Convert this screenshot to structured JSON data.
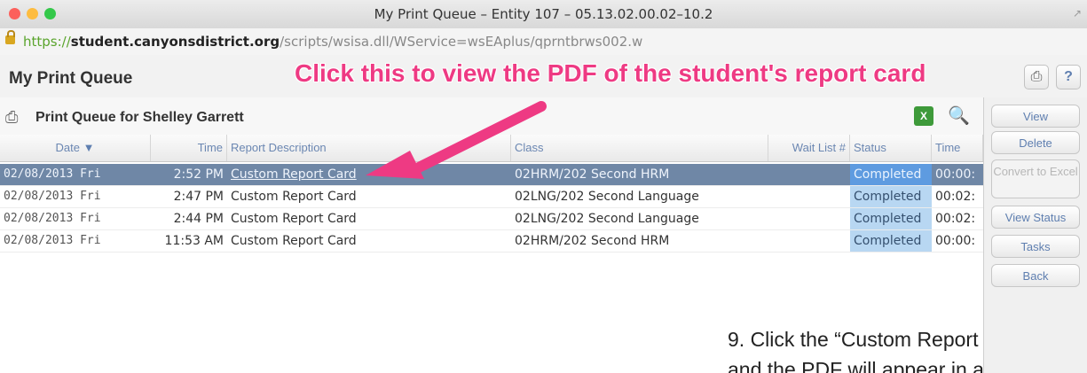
{
  "window": {
    "title": "My Print Queue – Entity 107 – 05.13.02.00.02–10.2",
    "controls": {
      "close_color": "#fc605c",
      "minimize_color": "#fdbc40",
      "zoom_color": "#34c84a"
    }
  },
  "address_bar": {
    "scheme": "https://",
    "host": "student.canyonsdistrict.org",
    "path": "/scripts/wsisa.dll/WService=wsEAplus/qprntbrws002.w"
  },
  "app": {
    "title": "My Print Queue",
    "header_icons": [
      "printer-icon",
      "help-icon"
    ],
    "help_label": "?"
  },
  "annotation": {
    "callout": "Click this to view the PDF of the student's report card",
    "callout_color": "#ee3a83",
    "instruction_line1": "9.  Click the “Custom Report",
    "instruction_line2": "and the PDF will appear in a"
  },
  "queue": {
    "heading": "Print Queue for Shelley Garrett",
    "toolbar_icons": [
      "excel-export-icon",
      "preview-icon"
    ],
    "columns": [
      "Date",
      "Time",
      "Report Description",
      "Class",
      "Wait List #",
      "Status",
      "Time"
    ],
    "rows": [
      {
        "date": "02/08/2013 Fri",
        "time": "2:52 PM",
        "description": "Custom Report Card",
        "class": "02HRM/202 Second HRM",
        "wait_list": "",
        "status": "Completed",
        "elapsed": "00:00:",
        "selected": true
      },
      {
        "date": "02/08/2013 Fri",
        "time": "2:47 PM",
        "description": "Custom Report Card",
        "class": "02LNG/202 Second Language",
        "wait_list": "",
        "status": "Completed",
        "elapsed": "00:02:",
        "selected": false
      },
      {
        "date": "02/08/2013 Fri",
        "time": "2:44 PM",
        "description": "Custom Report Card",
        "class": "02LNG/202 Second Language",
        "wait_list": "",
        "status": "Completed",
        "elapsed": "00:02:",
        "selected": false
      },
      {
        "date": "02/08/2013 Fri",
        "time": "11:53 AM",
        "description": "Custom Report Card",
        "class": "02HRM/202 Second HRM",
        "wait_list": "",
        "status": "Completed",
        "elapsed": "00:00:",
        "selected": false
      }
    ]
  },
  "sidebar": {
    "buttons": [
      {
        "label": "View",
        "enabled": true
      },
      {
        "label": "Delete",
        "enabled": true
      },
      {
        "label": "Convert to Excel",
        "enabled": false
      },
      {
        "label": "View Status",
        "enabled": true
      },
      {
        "label": "Tasks",
        "enabled": true
      },
      {
        "label": "Back",
        "enabled": true
      }
    ]
  }
}
